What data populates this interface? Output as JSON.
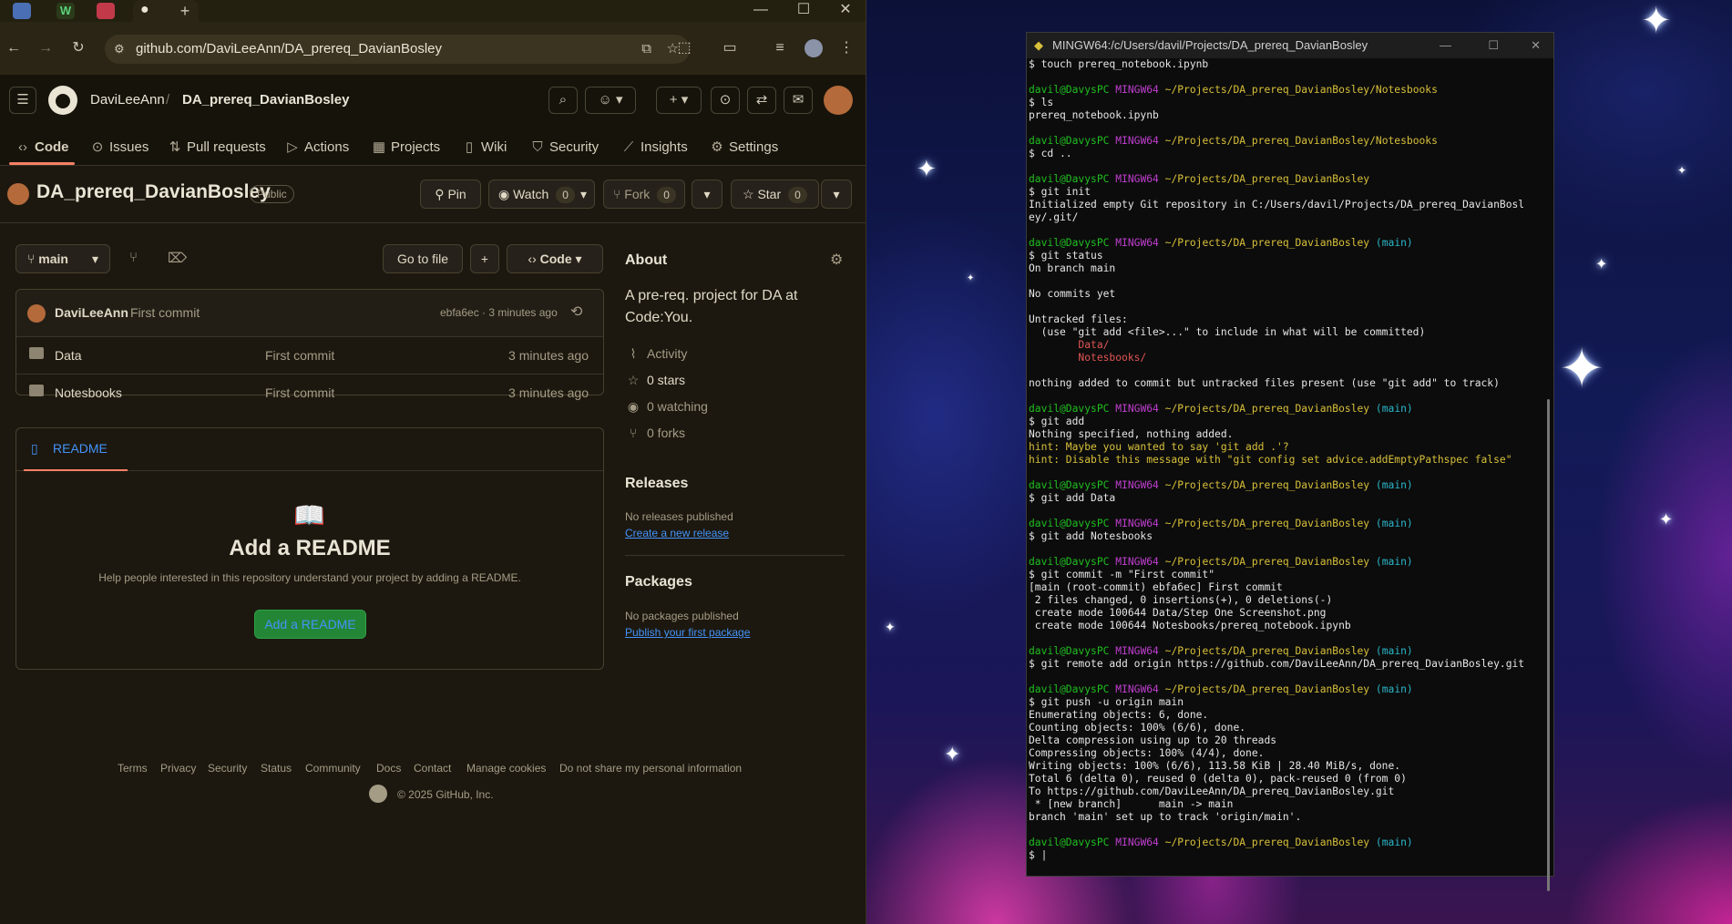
{
  "browser": {
    "url": "github.com/DaviLeeAnn/DA_prereq_DavianBosley",
    "tabs": [
      {
        "icon": "photos-tab-icon"
      },
      {
        "icon": "webflow-tab-icon"
      },
      {
        "icon": "app-tab-icon"
      },
      {
        "icon": "github-tab-icon",
        "active": true
      }
    ],
    "new_tab": "+",
    "window_controls": {
      "minimize": "—",
      "maximize": "☐",
      "close": "✕"
    }
  },
  "header": {
    "owner": "DaviLeeAnn",
    "separator": "/",
    "repo": "DA_prereq_DavianBosley"
  },
  "nav": {
    "tabs": [
      {
        "label": "Code",
        "icon": "code-icon"
      },
      {
        "label": "Issues",
        "icon": "issue-icon"
      },
      {
        "label": "Pull requests",
        "icon": "pull-request-icon"
      },
      {
        "label": "Actions",
        "icon": "play-icon"
      },
      {
        "label": "Projects",
        "icon": "table-icon"
      },
      {
        "label": "Wiki",
        "icon": "book-icon"
      },
      {
        "label": "Security",
        "icon": "shield-icon"
      },
      {
        "label": "Insights",
        "icon": "graph-icon"
      },
      {
        "label": "Settings",
        "icon": "gear-icon"
      }
    ]
  },
  "repo": {
    "title": "DA_prereq_DavianBosley",
    "visibility": "Public",
    "pin_label": "Pin",
    "watch_label": "Watch",
    "watch_count": "0",
    "fork_label": "Fork",
    "fork_count": "0",
    "star_label": "Star",
    "star_count": "0"
  },
  "files": {
    "branch": "main",
    "go_to_file": "Go to file",
    "add_label": "+",
    "code_label": "Code",
    "commit": {
      "author": "DaviLeeAnn",
      "message": "First commit",
      "hash_time": "ebfa6ec · 3 minutes ago"
    },
    "rows": [
      {
        "name": "Data",
        "message": "First commit",
        "time": "3 minutes ago"
      },
      {
        "name": "Notesbooks",
        "message": "First commit",
        "time": "3 minutes ago"
      }
    ]
  },
  "readme": {
    "tab": "README",
    "title": "Add a README",
    "description": "Help people interested in this repository understand your project by adding a README.",
    "button": "Add a README"
  },
  "about": {
    "title": "About",
    "description": "A pre-req. project for DA at Code:You.",
    "activity": "Activity",
    "stars": "0 stars",
    "watching": "0 watching",
    "forks": "0 forks"
  },
  "releases": {
    "title": "Releases",
    "empty": "No releases published",
    "link": "Create a new release"
  },
  "packages": {
    "title": "Packages",
    "empty": "No packages published",
    "link": "Publish your first package"
  },
  "footer": {
    "links": [
      "Terms",
      "Privacy",
      "Security",
      "Status",
      "Community",
      "Docs",
      "Contact",
      "Manage cookies",
      "Do not share my personal information"
    ],
    "copyright": "© 2025 GitHub, Inc."
  },
  "terminal": {
    "title": "MINGW64:/c/Users/davil/Projects/DA_prereq_DavianBosley",
    "prompt_user": "davil@DavysPC",
    "prompt_host": "MINGW64",
    "lines": [
      {
        "type": "cmd",
        "text": "$ touch prereq_notebook.ipynb"
      },
      {
        "type": "blank"
      },
      {
        "type": "prompt",
        "path": "~/Projects/DA_prereq_DavianBosley/Notesbooks"
      },
      {
        "type": "cmd",
        "text": "$ ls"
      },
      {
        "type": "out",
        "text": "prereq_notebook.ipynb"
      },
      {
        "type": "blank"
      },
      {
        "type": "prompt",
        "path": "~/Projects/DA_prereq_DavianBosley/Notesbooks"
      },
      {
        "type": "cmd",
        "text": "$ cd .."
      },
      {
        "type": "blank"
      },
      {
        "type": "prompt",
        "path": "~/Projects/DA_prereq_DavianBosley"
      },
      {
        "type": "cmd",
        "text": "$ git init"
      },
      {
        "type": "out",
        "text": "Initialized empty Git repository in C:/Users/davil/Projects/DA_prereq_DavianBosl"
      },
      {
        "type": "out",
        "text": "ey/.git/"
      },
      {
        "type": "blank"
      },
      {
        "type": "prompt",
        "path": "~/Projects/DA_prereq_DavianBosley",
        "branch": "(main)"
      },
      {
        "type": "cmd",
        "text": "$ git status"
      },
      {
        "type": "out",
        "text": "On branch main"
      },
      {
        "type": "blank"
      },
      {
        "type": "out",
        "text": "No commits yet"
      },
      {
        "type": "blank"
      },
      {
        "type": "out",
        "text": "Untracked files:"
      },
      {
        "type": "out",
        "text": "  (use \"git add <file>...\" to include in what will be committed)"
      },
      {
        "type": "red",
        "text": "        Data/"
      },
      {
        "type": "red",
        "text": "        Notesbooks/"
      },
      {
        "type": "blank"
      },
      {
        "type": "out",
        "text": "nothing added to commit but untracked files present (use \"git add\" to track)"
      },
      {
        "type": "blank"
      },
      {
        "type": "prompt",
        "path": "~/Projects/DA_prereq_DavianBosley",
        "branch": "(main)"
      },
      {
        "type": "cmd",
        "text": "$ git add"
      },
      {
        "type": "out",
        "text": "Nothing specified, nothing added."
      },
      {
        "type": "hint",
        "text": "hint: Maybe you wanted to say 'git add .'?"
      },
      {
        "type": "hint",
        "text": "hint: Disable this message with \"git config set advice.addEmptyPathspec false\""
      },
      {
        "type": "blank"
      },
      {
        "type": "prompt",
        "path": "~/Projects/DA_prereq_DavianBosley",
        "branch": "(main)"
      },
      {
        "type": "cmd",
        "text": "$ git add Data"
      },
      {
        "type": "blank"
      },
      {
        "type": "prompt",
        "path": "~/Projects/DA_prereq_DavianBosley",
        "branch": "(main)"
      },
      {
        "type": "cmd",
        "text": "$ git add Notesbooks"
      },
      {
        "type": "blank"
      },
      {
        "type": "prompt",
        "path": "~/Projects/DA_prereq_DavianBosley",
        "branch": "(main)"
      },
      {
        "type": "cmd",
        "text": "$ git commit -m \"First commit\""
      },
      {
        "type": "out",
        "text": "[main (root-commit) ebfa6ec] First commit"
      },
      {
        "type": "out",
        "text": " 2 files changed, 0 insertions(+), 0 deletions(-)"
      },
      {
        "type": "out",
        "text": " create mode 100644 Data/Step One Screenshot.png"
      },
      {
        "type": "out",
        "text": " create mode 100644 Notesbooks/prereq_notebook.ipynb"
      },
      {
        "type": "blank"
      },
      {
        "type": "prompt",
        "path": "~/Projects/DA_prereq_DavianBosley",
        "branch": "(main)"
      },
      {
        "type": "cmd",
        "text": "$ git remote add origin https://github.com/DaviLeeAnn/DA_prereq_DavianBosley.git"
      },
      {
        "type": "blank"
      },
      {
        "type": "prompt",
        "path": "~/Projects/DA_prereq_DavianBosley",
        "branch": "(main)"
      },
      {
        "type": "cmd",
        "text": "$ git push -u origin main"
      },
      {
        "type": "out",
        "text": "Enumerating objects: 6, done."
      },
      {
        "type": "out",
        "text": "Counting objects: 100% (6/6), done."
      },
      {
        "type": "out",
        "text": "Delta compression using up to 20 threads"
      },
      {
        "type": "out",
        "text": "Compressing objects: 100% (4/4), done."
      },
      {
        "type": "out",
        "text": "Writing objects: 100% (6/6), 113.58 KiB | 28.40 MiB/s, done."
      },
      {
        "type": "out",
        "text": "Total 6 (delta 0), reused 0 (delta 0), pack-reused 0 (from 0)"
      },
      {
        "type": "out",
        "text": "To https://github.com/DaviLeeAnn/DA_prereq_DavianBosley.git"
      },
      {
        "type": "out",
        "text": " * [new branch]      main -> main"
      },
      {
        "type": "out",
        "text": "branch 'main' set up to track 'origin/main'."
      },
      {
        "type": "blank"
      },
      {
        "type": "prompt",
        "path": "~/Projects/DA_prereq_DavianBosley",
        "branch": "(main)"
      },
      {
        "type": "cmd",
        "text": "$ |"
      }
    ]
  },
  "colors": {
    "accent": "#f78166",
    "link": "#4493f8",
    "green_button": "#238636",
    "terminal_user": "#1fbf1f",
    "terminal_host": "#c03fd0",
    "terminal_path": "#d8c03a",
    "terminal_branch": "#2ab7c9"
  }
}
